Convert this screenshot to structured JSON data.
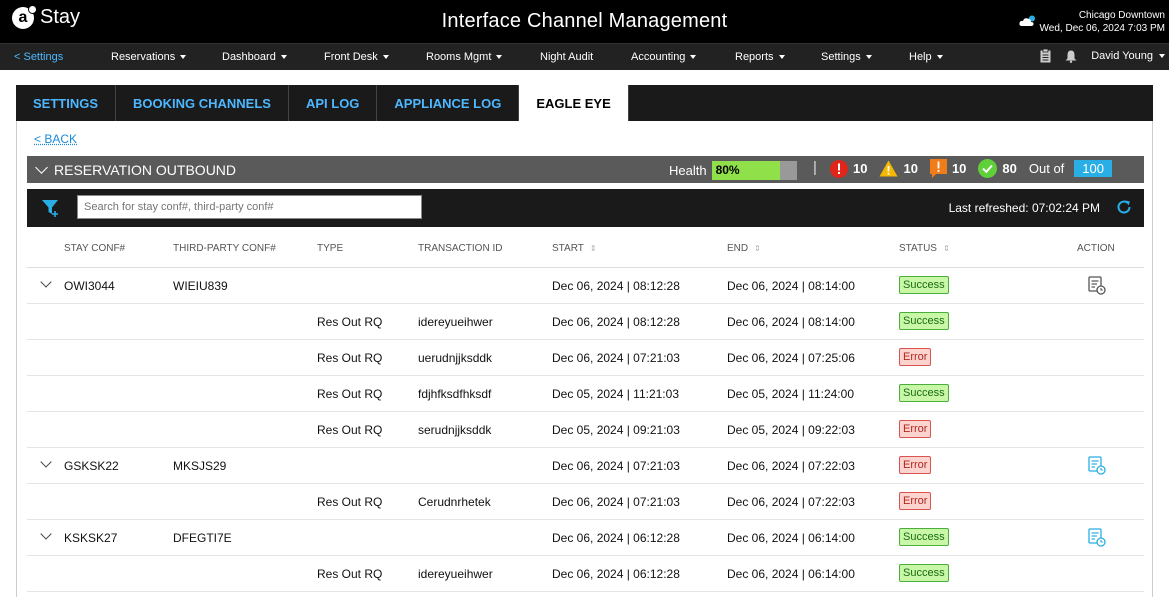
{
  "header": {
    "logo_text": "Stay",
    "title": "Interface Channel Management",
    "hotel": "Chicago Downtown",
    "datetime": "Wed, Dec 06, 2024 7:03 PM",
    "weather_icon": "cloud-icon"
  },
  "nav": {
    "back": "< Settings",
    "items": [
      {
        "label": "Reservations",
        "dropdown": true
      },
      {
        "label": "Dashboard",
        "dropdown": true
      },
      {
        "label": "Front Desk",
        "dropdown": true
      },
      {
        "label": "Rooms Mgmt",
        "dropdown": true
      },
      {
        "label": "Night Audit",
        "dropdown": false
      },
      {
        "label": "Accounting",
        "dropdown": true
      },
      {
        "label": "Reports",
        "dropdown": true
      },
      {
        "label": "Settings",
        "dropdown": true
      },
      {
        "label": "Help",
        "dropdown": true
      }
    ],
    "user": "David Young"
  },
  "tabs": [
    "SETTINGS",
    "BOOKING CHANNELS",
    "API LOG",
    "APPLIANCE LOG",
    "EAGLE EYE"
  ],
  "active_tab": "EAGLE EYE",
  "back_link": "< BACK",
  "panel": {
    "title": "RESERVATION OUTBOUND",
    "health_label": "Health",
    "health_value": "80%",
    "health_percent": 80,
    "error_count": "10",
    "warning_count": "10",
    "alert_count": "10",
    "success_count": "80",
    "out_of_label": "Out of",
    "total": "100"
  },
  "filter": {
    "search_placeholder": "Search for stay conf#, third-party conf#",
    "last_refreshed_label": "Last refreshed:",
    "last_refreshed_time": "07:02:24 PM"
  },
  "table": {
    "headers": {
      "stay_conf": "STAY CONF#",
      "third_party": "THIRD-PARTY CONF#",
      "type": "TYPE",
      "transaction": "TRANSACTION ID",
      "start": "START",
      "end": "END",
      "status": "STATUS",
      "action": "ACTION"
    },
    "sort_glyph": "⇕",
    "rows": [
      {
        "group": true,
        "stay_conf": "OWI3044",
        "third_party": "WIEIU839",
        "type": "",
        "transaction": "",
        "start": "Dec 06, 2024 | 08:12:28",
        "end": "Dec 06, 2024 | 08:14:00",
        "status": "Success",
        "action_color": "#555555"
      },
      {
        "group": false,
        "stay_conf": "",
        "third_party": "",
        "type": "Res Out RQ",
        "transaction": "idereyueihwer",
        "start": "Dec 06, 2024 | 08:12:28",
        "end": "Dec 06, 2024 | 08:14:00",
        "status": "Success"
      },
      {
        "group": false,
        "stay_conf": "",
        "third_party": "",
        "type": "Res Out RQ",
        "transaction": "uerudnjjksddk",
        "start": "Dec 06, 2024 | 07:21:03",
        "end": "Dec 06, 2024 | 07:25:06",
        "status": "Error"
      },
      {
        "group": false,
        "stay_conf": "",
        "third_party": "",
        "type": "Res Out RQ",
        "transaction": "fdjhfksdfhksdf",
        "start": "Dec 05, 2024 | 11:21:03",
        "end": "Dec 05, 2024 | 11:24:00",
        "status": "Success"
      },
      {
        "group": false,
        "stay_conf": "",
        "third_party": "",
        "type": "Res Out RQ",
        "transaction": "serudnjjksddk",
        "start": "Dec 05, 2024 | 09:21:03",
        "end": "Dec 05, 2024 | 09:22:03",
        "status": "Error"
      },
      {
        "group": true,
        "stay_conf": "GSKSK22",
        "third_party": "MKSJS29",
        "type": "",
        "transaction": "",
        "start": "Dec 06, 2024 | 07:21:03",
        "end": "Dec 06, 2024 | 07:22:03",
        "status": "Error",
        "action_color": "#29aee6"
      },
      {
        "group": false,
        "stay_conf": "",
        "third_party": "",
        "type": "Res Out RQ",
        "transaction": "Cerudnrhetek",
        "start": "Dec 06, 2024 | 07:21:03",
        "end": "Dec 06, 2024 | 07:22:03",
        "status": "Error"
      },
      {
        "group": true,
        "stay_conf": "KSKSK27",
        "third_party": "DFEGTI7E",
        "type": "",
        "transaction": "",
        "start": "Dec 06, 2024 | 06:12:28",
        "end": "Dec 06, 2024 | 06:14:00",
        "status": "Success",
        "action_color": "#29aee6"
      },
      {
        "group": false,
        "stay_conf": "",
        "third_party": "",
        "type": "Res Out RQ",
        "transaction": "idereyueihwer",
        "start": "Dec 06, 2024 | 06:12:28",
        "end": "Dec 06, 2024 | 06:14:00",
        "status": "Success"
      }
    ]
  },
  "colors": {
    "accent": "#29aee6",
    "link": "#4db8ff",
    "success": "#90e04a",
    "error": "#d9534f",
    "warning": "#f5b800",
    "alert": "#f07c1a"
  }
}
